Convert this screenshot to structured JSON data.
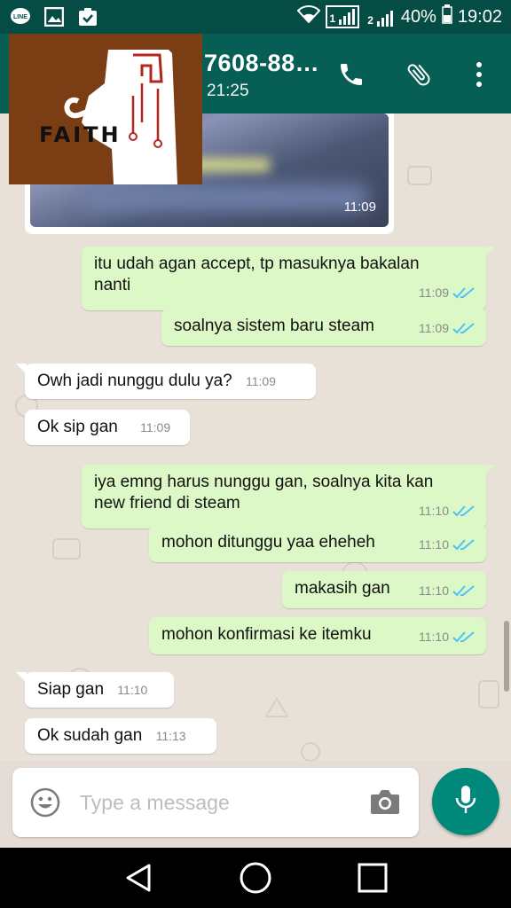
{
  "status_bar": {
    "battery": "40%",
    "time": "19:02",
    "sim1": "1",
    "sim2": "2",
    "left_icons": [
      "line-icon",
      "gallery-icon",
      "task-icon"
    ]
  },
  "header": {
    "contact_name": "7608-88…",
    "last_seen": "21:25",
    "actions": [
      "phone-icon",
      "attach-icon",
      "more-icon"
    ]
  },
  "avatar": {
    "logo_text": "FAITH",
    "colors": {
      "background": "#7b3d14",
      "shape": "#ffffff",
      "accent": "#b3261e"
    }
  },
  "chat": {
    "image_message": {
      "time": "11:09"
    },
    "messages": [
      {
        "dir": "out",
        "line1": "itu udah agan accept, tp masuknya bakalan",
        "line2": "nanti",
        "time": "11:09",
        "status": "read"
      },
      {
        "dir": "out",
        "line1": "soalnya sistem baru steam",
        "line2": "",
        "time": "11:09",
        "status": "read"
      },
      {
        "dir": "in",
        "line1": "Owh jadi nunggu dulu ya?",
        "line2": "",
        "time": "11:09"
      },
      {
        "dir": "in",
        "line1": "Ok sip gan",
        "line2": "",
        "time": "11:09"
      },
      {
        "dir": "out",
        "line1": "iya emng harus nunggu gan, soalnya kita kan",
        "line2": "new friend di steam",
        "time": "11:10",
        "status": "read"
      },
      {
        "dir": "out",
        "line1": "mohon ditunggu yaa eheheh",
        "line2": "",
        "time": "11:10",
        "status": "read"
      },
      {
        "dir": "out",
        "line1": "makasih gan",
        "line2": "",
        "time": "11:10",
        "status": "read"
      },
      {
        "dir": "out",
        "line1": "mohon konfirmasi ke itemku",
        "line2": "",
        "time": "11:10",
        "status": "read"
      },
      {
        "dir": "in",
        "line1": "Siap gan",
        "line2": "",
        "time": "11:10"
      },
      {
        "dir": "in",
        "line1": "Ok sudah gan",
        "line2": "",
        "time": "11:13"
      }
    ]
  },
  "composer": {
    "placeholder": "Type a message",
    "value": ""
  },
  "colors": {
    "header": "#075e54",
    "status_bar": "#054d44",
    "outgoing_bubble": "#dcf8c6",
    "incoming_bubble": "#ffffff",
    "read_tick": "#4fc3f7",
    "mic_button": "#00897b"
  }
}
